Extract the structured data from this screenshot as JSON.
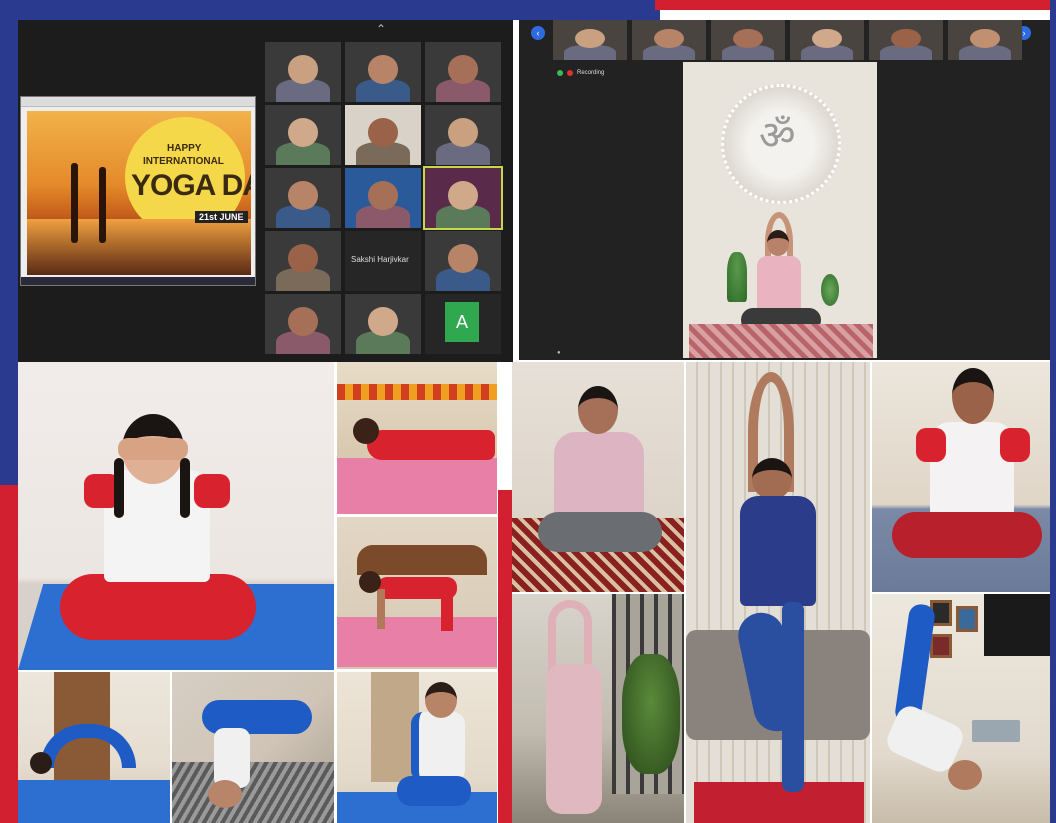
{
  "colors": {
    "frame_blue": "#2a3b8f",
    "frame_red": "#d32030",
    "meeting_bg": "#1c1c1c",
    "mat_blue": "#2c6fd0",
    "mat_pink": "#e77fa7",
    "uniform_red": "#d8222e",
    "uniform_blue": "#1e5bc4"
  },
  "poster": {
    "line1": "HAPPY",
    "line2": "INTERNATIONAL",
    "line3": "YOGA DAY",
    "date": "21st JUNE"
  },
  "meeting_grid": {
    "center_name": "Sakshi Harjivkar",
    "avatar_letter": "A"
  },
  "session": {
    "recording_label": "Recording",
    "om_symbol": "ॐ"
  },
  "icons": [
    "participant-tile-icons",
    "recording-dot-icon",
    "mic-muted-icon",
    "nav-left-icon",
    "nav-right-icon",
    "collapse-chevron-icon"
  ]
}
